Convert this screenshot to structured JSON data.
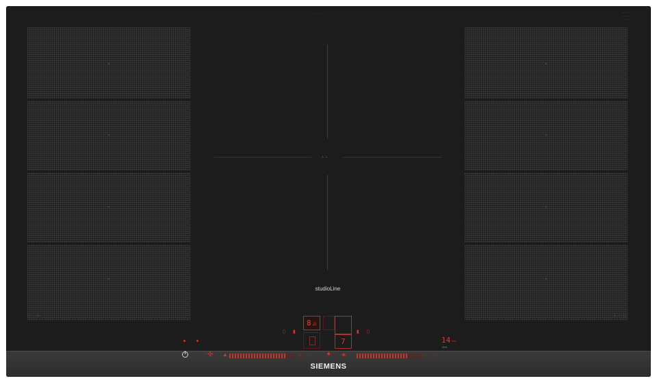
{
  "product": {
    "series_label": "studioLine",
    "brand_logo": "SIEMENS"
  },
  "top_marks": {
    "center_text": "·········",
    "corner_badge_line1": "········",
    "corner_badge_line2": "········",
    "corner_badge_line3": "······"
  },
  "zone_labels": {
    "left_bottom": "▢ ··· ⟂",
    "right_bottom": "⟂ ··· ▢",
    "center": "⟂ ⟂"
  },
  "display": {
    "left_power_level": "8.",
    "left_power_sub": "5",
    "right_power_level": "7",
    "timer_value": "14",
    "timer_unit": "min",
    "timer_sub": "MIN"
  },
  "controls": {
    "power_icon": "power-icon",
    "fan_icon": "fan-icon",
    "left_arrow_icon": "arrow-icon",
    "right_arrow_icon": "arrow-icon",
    "left_slider_level": 0.85,
    "right_slider_level": 0.8
  },
  "colors": {
    "glass": "#1b1c1b",
    "display_red": "#d9322a",
    "strip": "#343534",
    "logo": "#f0f0f0"
  }
}
